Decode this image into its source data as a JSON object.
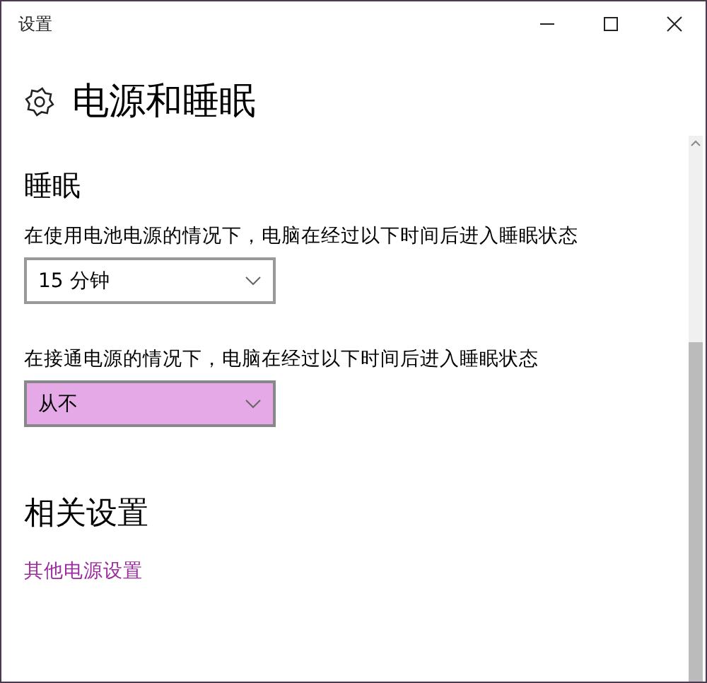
{
  "window": {
    "title": "设置"
  },
  "header": {
    "title": "电源和睡眠"
  },
  "sections": [
    {
      "title": "睡眠",
      "settings": [
        {
          "label": "在使用电池电源的情况下，电脑在经过以下时间后进入睡眠状态",
          "value": "15 分钟",
          "highlighted": false
        },
        {
          "label": "在接通电源的情况下，电脑在经过以下时间后进入睡眠状态",
          "value": "从不",
          "highlighted": true
        }
      ]
    }
  ],
  "related": {
    "title": "相关设置",
    "links": [
      "其他电源设置"
    ]
  }
}
